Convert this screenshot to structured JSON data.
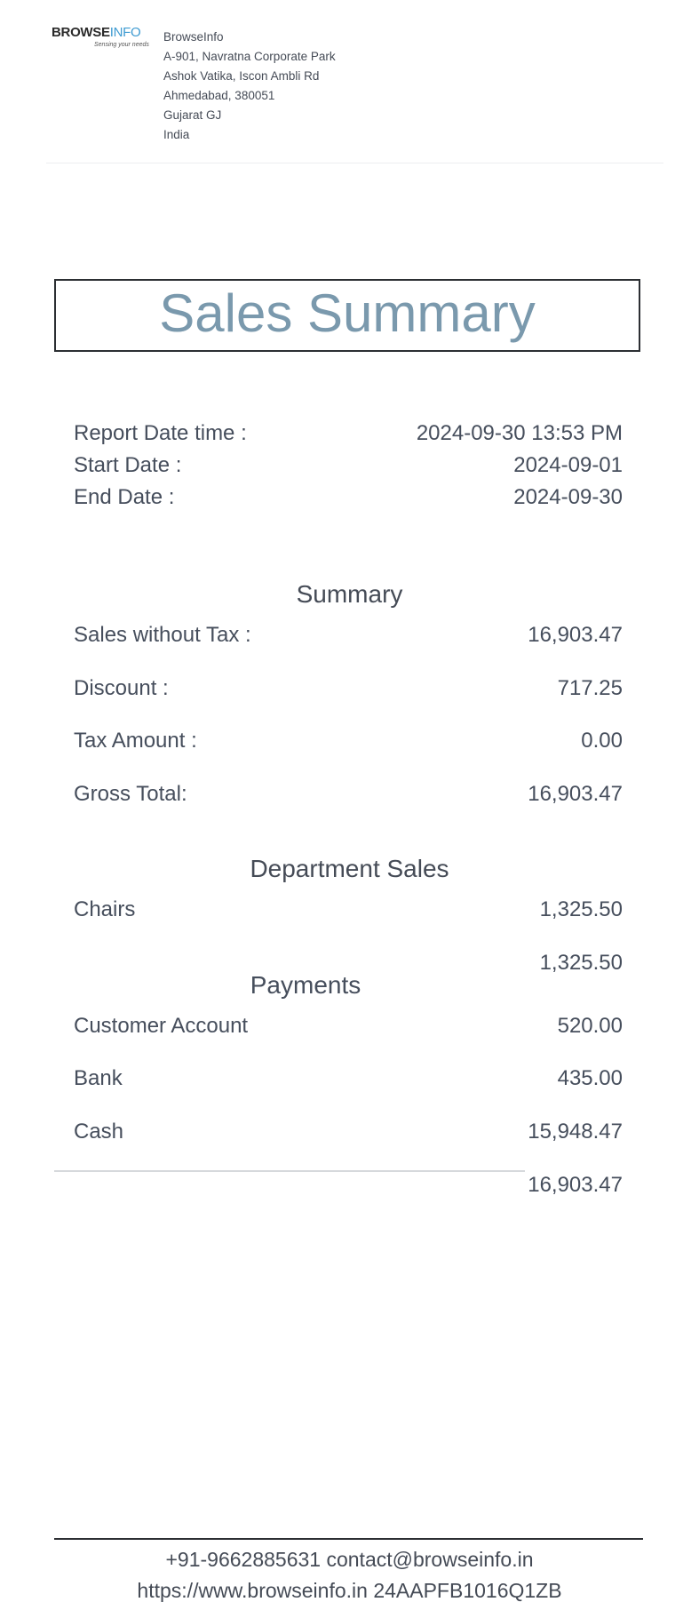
{
  "header": {
    "logo": {
      "brand_dark": "BROWSE",
      "brand_accent": "INFO",
      "tagline": "Sensing your needs"
    },
    "company": {
      "name": "BrowseInfo",
      "address_line1": "A-901, Navratna Corporate Park",
      "address_line2": "Ashok Vatika, Iscon Ambli Rd",
      "city_zip": "Ahmedabad, 380051",
      "state": "Gujarat GJ",
      "country": "India"
    }
  },
  "title": "Sales Summary",
  "dates": [
    {
      "label": "Report Date time :",
      "value": "2024-09-30 13:53 PM"
    },
    {
      "label": "Start Date :",
      "value": "2024-09-01"
    },
    {
      "label": "End Date :",
      "value": "2024-09-30"
    }
  ],
  "summary": {
    "title": "Summary",
    "rows": [
      {
        "label": "Sales without Tax :",
        "value": "16,903.47"
      },
      {
        "label": "Discount :",
        "value": "717.25"
      },
      {
        "label": "Tax Amount :",
        "value": "0.00"
      },
      {
        "label": "Gross Total:",
        "value": "16,903.47"
      }
    ]
  },
  "department_sales": {
    "title": "Department Sales",
    "rows": [
      {
        "label": "Chairs",
        "value": "1,325.50"
      }
    ],
    "total": "1,325.50"
  },
  "payments": {
    "title": "Payments",
    "rows": [
      {
        "label": "Customer Account",
        "value": "520.00"
      },
      {
        "label": "Bank",
        "value": "435.00"
      },
      {
        "label": "Cash",
        "value": "15,948.47"
      }
    ],
    "total": "16,903.47"
  },
  "footer": {
    "phone": "+91-9662885631",
    "email": "contact@browseinfo.in",
    "website": "https://www.browseinfo.in",
    "tax_id": "24AAPFB1016Q1ZB"
  },
  "colors": {
    "title": "#7a99ad",
    "logo_accent": "#3d9ad1",
    "text": "#464e5c"
  }
}
